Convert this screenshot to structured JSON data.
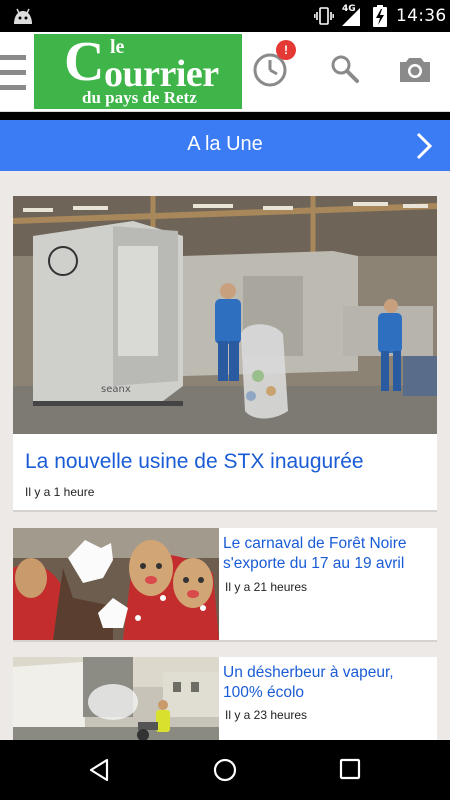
{
  "status_bar": {
    "network": "4G",
    "time": "14:36",
    "icons": [
      "android-icon",
      "vibrate-icon",
      "signal-icon",
      "battery-icon"
    ]
  },
  "header": {
    "logo": {
      "le": "le",
      "c": "C",
      "ourrier": "ourrier",
      "subtitle": "du pays de Retz",
      "color": "#3fb549"
    },
    "notification_count": "!",
    "icons": [
      "menu-icon",
      "history-icon",
      "search-icon",
      "camera-icon"
    ]
  },
  "section": {
    "title": "A la Une",
    "color": "#3b7cf5"
  },
  "articles": [
    {
      "title": "La nouvelle usine de STX inaugurée",
      "time": "Il y a 1 heure",
      "photo_label": "seanx"
    },
    {
      "title": "Le carnaval de Forêt Noire s'exporte du 17 au 19 avril",
      "time": "Il y a 21 heures"
    },
    {
      "title": "Un désherbeur à vapeur, 100% écolo",
      "time": "Il y a 23 heures"
    }
  ],
  "colors": {
    "link": "#1a5cd6",
    "background": "#ece9e6",
    "badge": "#e53935"
  }
}
